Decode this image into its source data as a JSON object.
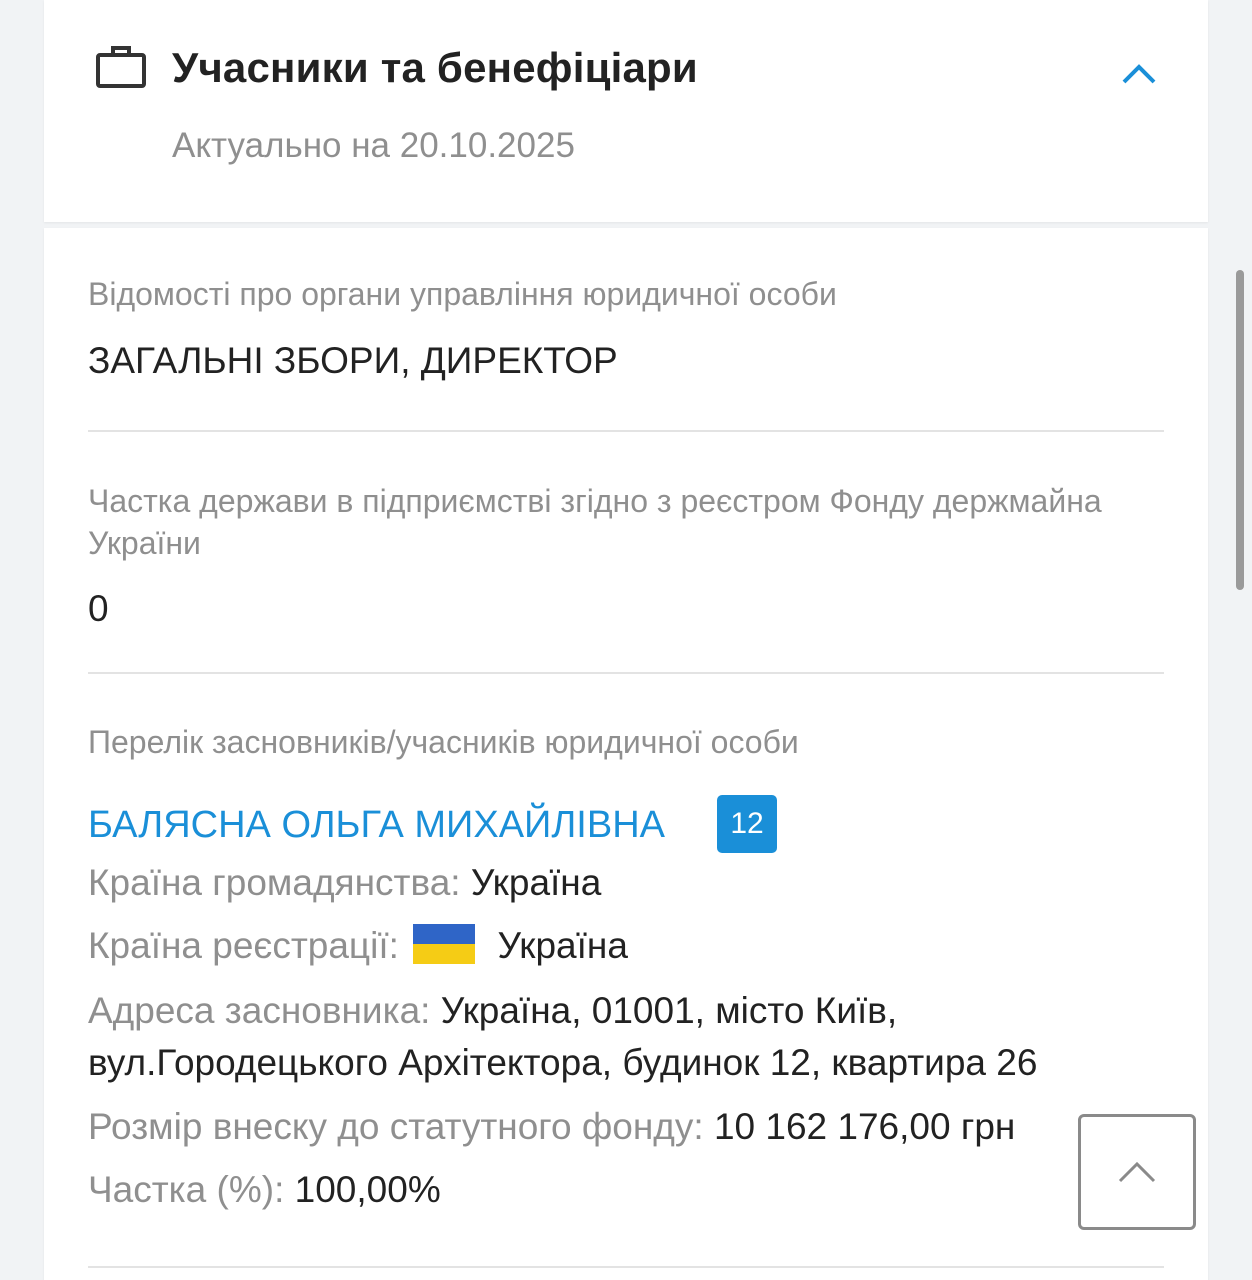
{
  "header": {
    "title": "Учасники та бенефіціари",
    "subtitle": "Актуально на 20.10.2025",
    "icon": "briefcase-icon",
    "collapse_icon": "chevron-up-icon",
    "accent_color": "#1a8fd8"
  },
  "management": {
    "label": "Відомості про органи управління юридичної особи",
    "value": "ЗАГАЛЬНІ ЗБОРИ, ДИРЕКТОР"
  },
  "state_share": {
    "label": "Частка держави в підприємстві згідно з реєстром Фонду держмайна України",
    "value": "0"
  },
  "founders": {
    "label": "Перелік засновників/учасників юридичної особи",
    "items": [
      {
        "name": "БАЛЯСНА ОЛЬГА МИХАЙЛІВНА",
        "badge": "12",
        "citizenship_label": "Країна громадянства:",
        "citizenship_value": "Україна",
        "registration_label": "Країна реєстрації:",
        "registration_value": "Україна",
        "registration_flag": "ukraine-flag-icon",
        "address_label": "Адреса засновника:",
        "address_line1": "Україна, 01001, місто Київ,",
        "address_line2": "вул.Городецького Архітектора, будинок 12, квартира 26",
        "contribution_label": "Розмір внеску до статутного фонду:",
        "contribution_value": "10 162 176,00 грн",
        "share_label": "Частка (%):",
        "share_value": "100,00%"
      }
    ]
  },
  "scroll_top_icon": "chevron-up-icon"
}
